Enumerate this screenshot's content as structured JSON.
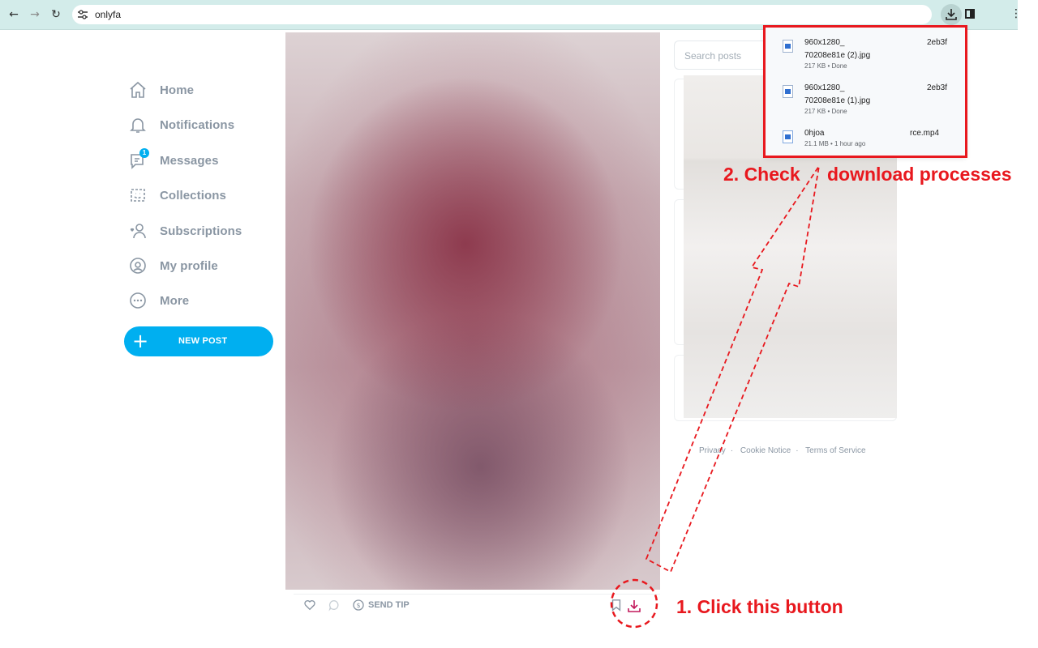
{
  "browser": {
    "url": "onlyfa",
    "back_icon": "arrow-left-icon",
    "forward_icon": "arrow-right-icon",
    "reload_icon": "reload-icon",
    "download_icon": "download-icon"
  },
  "nav": {
    "items": [
      {
        "label": "Home",
        "icon": "home-icon"
      },
      {
        "label": "Notifications",
        "icon": "bell-icon"
      },
      {
        "label": "Messages",
        "icon": "message-icon",
        "badge": "1"
      },
      {
        "label": "Collections",
        "icon": "collections-icon"
      },
      {
        "label": "Subscriptions",
        "icon": "subscriptions-icon"
      },
      {
        "label": "My profile",
        "icon": "profile-icon"
      },
      {
        "label": "More",
        "icon": "more-icon"
      }
    ],
    "new_post": "NEW POST"
  },
  "post": {
    "send_tip": "SEND TIP"
  },
  "search": {
    "placeholder": "Search posts"
  },
  "footer": {
    "privacy": "Privacy",
    "cookie": "Cookie Notice",
    "terms": "Terms of Service"
  },
  "downloads": [
    {
      "name1": "960x1280_",
      "name2": "70208e81e (2).jpg",
      "tail": "2eb3f",
      "meta": "217 KB • Done"
    },
    {
      "name1": "960x1280_",
      "name2": "70208e81e (1).jpg",
      "tail": "2eb3f",
      "meta": "217 KB • Done"
    },
    {
      "name1": "0hjoa",
      "name2": "",
      "tail": "rce.mp4",
      "meta": "21.1 MB • 1 hour ago"
    }
  ],
  "annotations": {
    "step1": "1. Click this button",
    "step2a": "2. Check",
    "step2b": "download processes"
  },
  "colors": {
    "accent": "#00aff0",
    "annotation": "#e8181e",
    "nav_text": "#8a96a3",
    "chrome": "#d3ecea"
  }
}
